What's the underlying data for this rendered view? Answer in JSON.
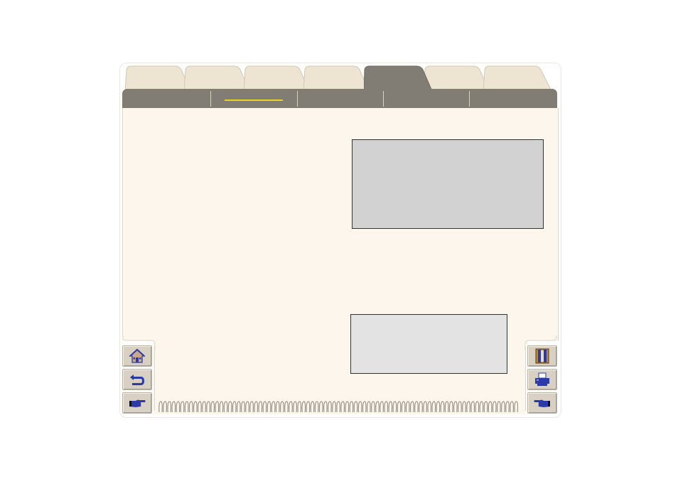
{
  "tabs": [
    {
      "name": "tab-1",
      "label": "",
      "active": false
    },
    {
      "name": "tab-2",
      "label": "",
      "active": false
    },
    {
      "name": "tab-3",
      "label": "",
      "active": false
    },
    {
      "name": "tab-4",
      "label": "",
      "active": false
    },
    {
      "name": "tab-5",
      "label": "",
      "active": true
    },
    {
      "name": "tab-6",
      "label": "",
      "active": false
    },
    {
      "name": "tab-7",
      "label": "",
      "active": false
    }
  ],
  "subnav": {
    "items": [
      "",
      "",
      "",
      "",
      ""
    ],
    "selected_index": 1
  },
  "content": {
    "box_top_text": "",
    "box_bottom_text": ""
  },
  "left_buttons": [
    {
      "icon": "home-icon"
    },
    {
      "icon": "back-arrow-icon"
    },
    {
      "icon": "pointing-hand-right-icon"
    }
  ],
  "right_buttons": [
    {
      "icon": "index-book-icon"
    },
    {
      "icon": "printer-icon"
    },
    {
      "icon": "pointing-hand-left-icon"
    }
  ],
  "colors": {
    "panel_background": "#fcf6ec",
    "tab_inactive": "#ede4d2",
    "tab_active": "#817c74",
    "selection_underline": "#e8d21d",
    "icon_blue": "#2b3aa8"
  }
}
